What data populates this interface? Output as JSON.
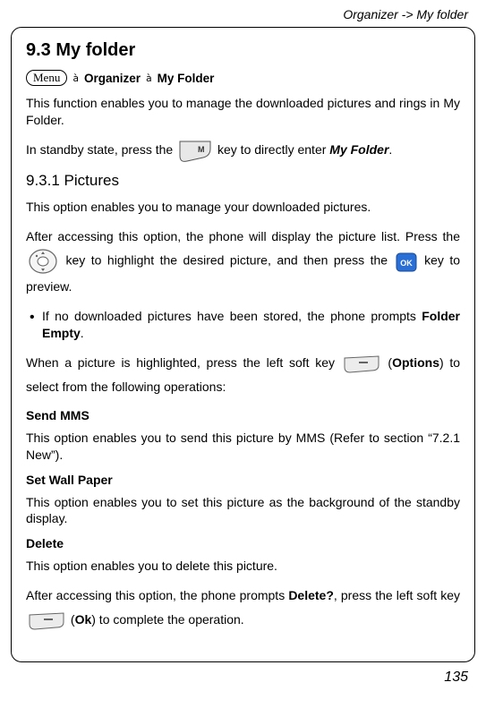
{
  "header_path": "Organizer -> My folder",
  "section_title": "9.3 My folder",
  "breadcrumb": {
    "menu": "Menu",
    "organizer": "Organizer",
    "myfolder": "My Folder"
  },
  "intro_text": "This function enables you to manage the downloaded pictures and rings in My Folder.",
  "standby_text_1": "In standby state, press the ",
  "standby_text_2": " key to directly enter ",
  "standby_myfolder": "My Folder",
  "standby_period": ".",
  "subsection_title": "9.3.1 Pictures",
  "pictures_intro": "This option enables you to manage your downloaded pictures.",
  "pictures_p2_a": "After accessing this option, the phone will display the picture list. Press the ",
  "pictures_p2_b": " key to highlight the desired picture, and then press the ",
  "pictures_p2_c": " key to preview.",
  "bullet_text_a": "If no downloaded pictures have been stored, the phone prompts ",
  "bullet_bold": "Folder Empty",
  "bullet_period": ".",
  "highlight_text_a": "When a picture is highlighted, press the left soft key ",
  "highlight_text_b": " (",
  "highlight_options": "Options",
  "highlight_text_c": ") to select from the following operations:",
  "send_mms_title": "Send MMS",
  "send_mms_text": "This option enables you to send this picture by MMS (Refer to section “7.2.1 New”).",
  "wallpaper_title": "Set Wall Paper",
  "wallpaper_text": "This option enables you to set this picture as the background of the standby display.",
  "delete_title": "Delete",
  "delete_text": "This option enables you to delete this picture.",
  "delete_p2_a": "After accessing this option, the phone prompts ",
  "delete_prompt": "Delete?",
  "delete_p2_b": ", press the left soft key ",
  "delete_p2_c": " (",
  "delete_ok": "Ok",
  "delete_p2_d": ") to complete the operation.",
  "page_number": "135"
}
